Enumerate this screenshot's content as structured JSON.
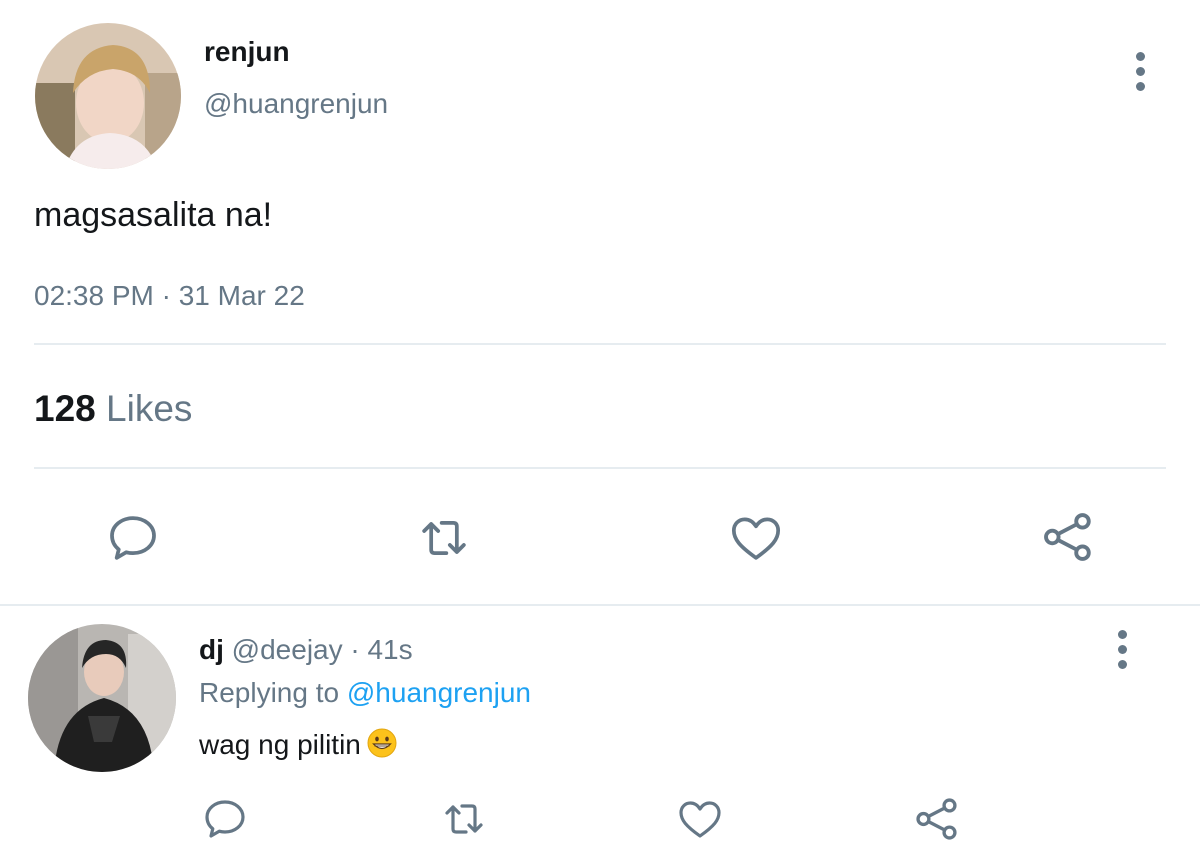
{
  "tweet": {
    "display_name": "renjun",
    "handle": "@huangrenjun",
    "text": "magsasalita na!",
    "timestamp": "02:38 PM · 31 Mar 22",
    "likes_count": "128",
    "likes_label": "Likes"
  },
  "reply": {
    "display_name": "dj",
    "handle_time": "@deejay · 41s",
    "replying_prefix": "Replying to",
    "replying_mention": "@huangrenjun",
    "text": "wag ng pilitin",
    "emoji": "grinning-face-emoji"
  },
  "icons": {
    "actions": [
      "reply-icon",
      "retweet-icon",
      "like-icon",
      "share-icon"
    ],
    "menu": "more-options-icon"
  },
  "colors": {
    "icon": "#657786",
    "mention": "#1da1f2",
    "divider": "#e6ecf0"
  }
}
